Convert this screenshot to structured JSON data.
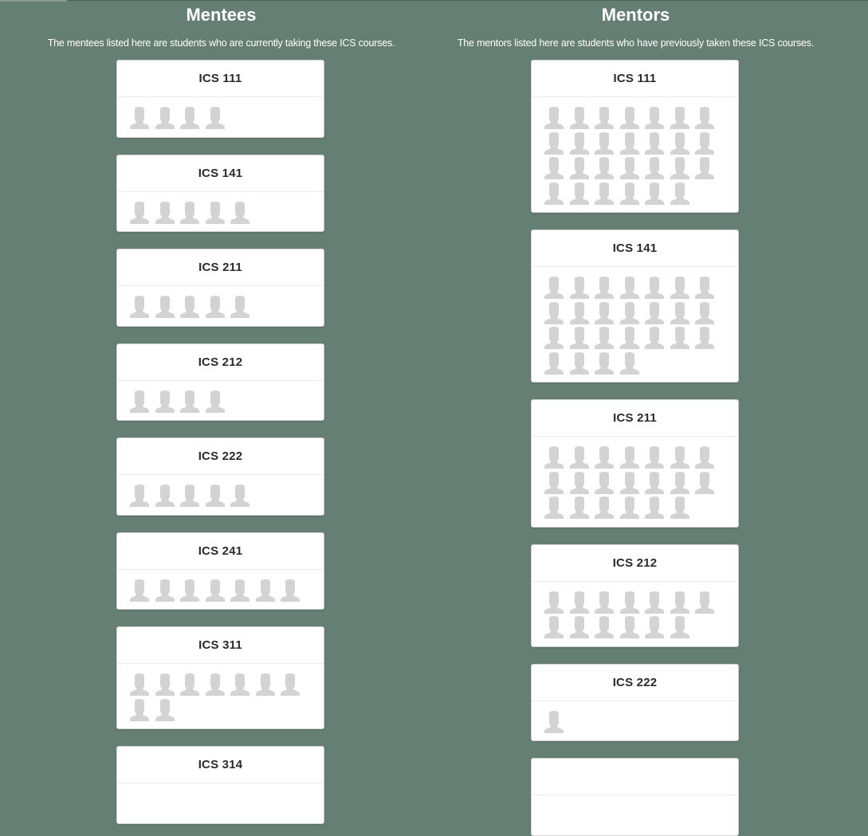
{
  "mentees": {
    "heading": "Mentees",
    "description": "The mentees listed here are students who are currently taking these ICS courses.",
    "courses": [
      {
        "name": "ICS 111",
        "count": 4
      },
      {
        "name": "ICS 141",
        "count": 5
      },
      {
        "name": "ICS 211",
        "count": 5
      },
      {
        "name": "ICS 212",
        "count": 4
      },
      {
        "name": "ICS 222",
        "count": 5
      },
      {
        "name": "ICS 241",
        "count": 7
      },
      {
        "name": "ICS 311",
        "count": 9
      },
      {
        "name": "ICS 314",
        "count": 0
      }
    ]
  },
  "mentors": {
    "heading": "Mentors",
    "description": "The mentors listed here are students who have previously taken these ICS courses.",
    "courses": [
      {
        "name": "ICS 111",
        "count": 27
      },
      {
        "name": "ICS 141",
        "count": 25
      },
      {
        "name": "ICS 211",
        "count": 20
      },
      {
        "name": "ICS 212",
        "count": 13
      },
      {
        "name": "ICS 222",
        "count": 1
      },
      {
        "name": "",
        "count": 0
      }
    ]
  },
  "icons": {
    "avatar": "user-silhouette-icon"
  },
  "colors": {
    "background": "#667f75",
    "card": "#ffffff",
    "avatar": "#d3d3d3",
    "heading_text": "#ffffff"
  }
}
